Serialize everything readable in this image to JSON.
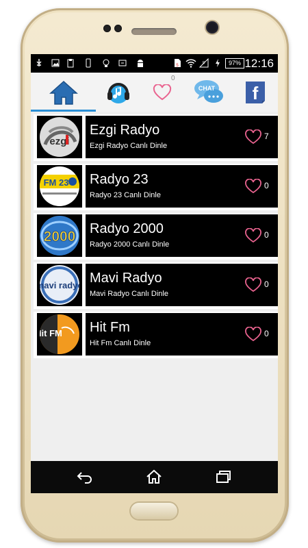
{
  "status_bar": {
    "time": "12:16",
    "battery": "97%",
    "icons": [
      "usb-icon",
      "image-icon",
      "clipboard-icon",
      "phone-icon",
      "bulb-icon",
      "sync-icon",
      "android-icon",
      "sim-icon",
      "wifi-icon",
      "signal-icon",
      "charging-icon"
    ]
  },
  "tabs": [
    {
      "name": "home",
      "icon": "home-icon",
      "active": true
    },
    {
      "name": "music",
      "icon": "headphones-music-icon"
    },
    {
      "name": "favorites",
      "icon": "heart-icon",
      "count": "0"
    },
    {
      "name": "chat",
      "icon": "chat-bubble-icon",
      "label": "CHAT"
    },
    {
      "name": "facebook",
      "icon": "facebook-icon",
      "label": "f"
    }
  ],
  "stations": [
    {
      "title": "Ezgi Radyo",
      "subtitle": "Ezgi Radyo Canlı Dinle",
      "likes": "7",
      "logo": "ezgi-logo"
    },
    {
      "title": "Radyo 23",
      "subtitle": "Radyo 23 Canlı Dinle",
      "likes": "0",
      "logo": "radyo23-logo"
    },
    {
      "title": "Radyo 2000",
      "subtitle": "Radyo 2000 Canlı Dinle",
      "likes": "0",
      "logo": "radyo2000-logo"
    },
    {
      "title": "Mavi Radyo",
      "subtitle": "Mavi Radyo Canlı Dinle",
      "likes": "0",
      "logo": "mavi-logo"
    },
    {
      "title": "Hit Fm",
      "subtitle": "Hit Fm Canlı Dinle",
      "likes": "0",
      "logo": "hitfm-logo"
    }
  ],
  "nav_bar": {
    "icons": [
      "back-icon",
      "home-icon",
      "recent-apps-icon"
    ]
  },
  "colors": {
    "accent": "#2a8fd6",
    "heart": "#e9638f",
    "row_bg": "#000000",
    "list_bg": "#efefef"
  },
  "logo_texts": {
    "ezgi": "ezgi",
    "radyo23": "FM 23",
    "radyo2000": "2000",
    "mavi": "mavi radyo",
    "hitfm": "Hit FM"
  }
}
